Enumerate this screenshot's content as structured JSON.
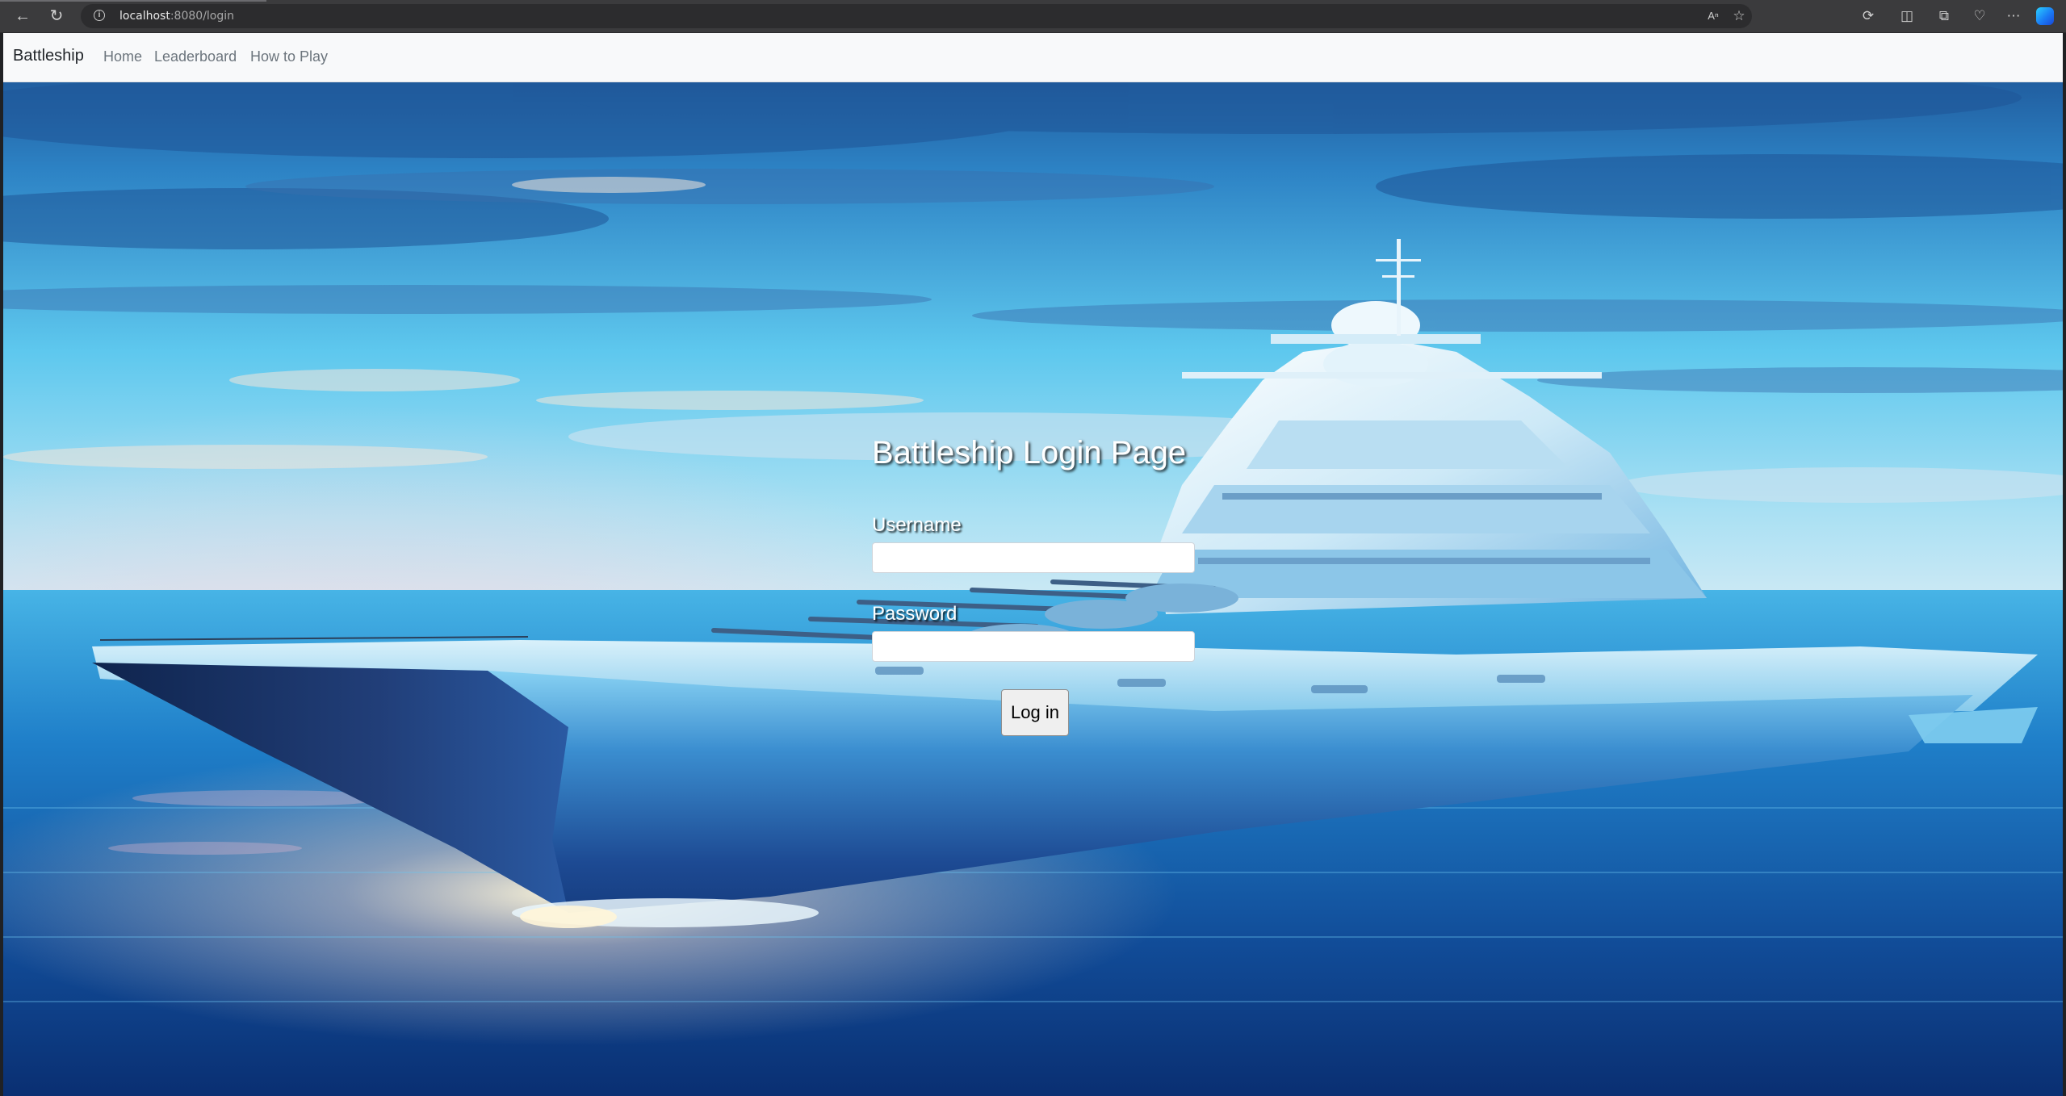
{
  "browser": {
    "url_host": "localhost",
    "url_rest": ":8080/login"
  },
  "navbar": {
    "brand": "Battleship",
    "links": [
      "Home",
      "Leaderboard",
      "How to Play"
    ]
  },
  "login": {
    "title": "Battleship Login Page",
    "username_label": "Username",
    "username_value": "",
    "password_label": "Password",
    "password_value": "",
    "submit_label": "Log in"
  },
  "colors": {
    "navbar_bg": "#f8f9fa",
    "sky_top": "#1d4f8f",
    "sky_mid": "#5fc3ea",
    "sea": "#0d3f86"
  }
}
